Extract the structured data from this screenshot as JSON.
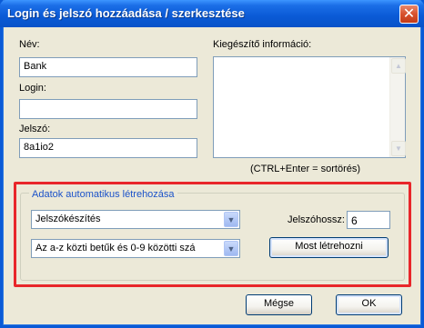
{
  "window": {
    "title": "Login és jelszó hozzáadása / szerkesztése",
    "close_glyph": "✕"
  },
  "form": {
    "name_label": "Név:",
    "name_value": "Bank",
    "login_label": "Login:",
    "login_value": "",
    "password_label": "Jelszó:",
    "password_value": "8a1io2",
    "extra_label": "Kiegészítő információ:",
    "extra_value": "",
    "hint": "(CTRL+Enter = sortörés)"
  },
  "generator": {
    "group_title": "Adatok automatikus létrehozása",
    "mode_selected": "Jelszókészítés",
    "charset_selected": "Az a-z közti betűk és 0-9 közötti szá",
    "length_label": "Jelszóhossz:",
    "length_value": "6",
    "generate_button": "Most létrehozni"
  },
  "buttons": {
    "cancel": "Mégse",
    "ok": "OK"
  },
  "icons": {
    "close": "close-icon",
    "dropdown": "chevron-down-icon",
    "scroll_up": "scroll-up-icon",
    "scroll_down": "scroll-down-icon"
  },
  "colors": {
    "titlebar": "#0a5ad6",
    "highlight_border": "#e8262a",
    "group_title": "#1b52c9",
    "dialog_bg": "#ece9d8"
  }
}
